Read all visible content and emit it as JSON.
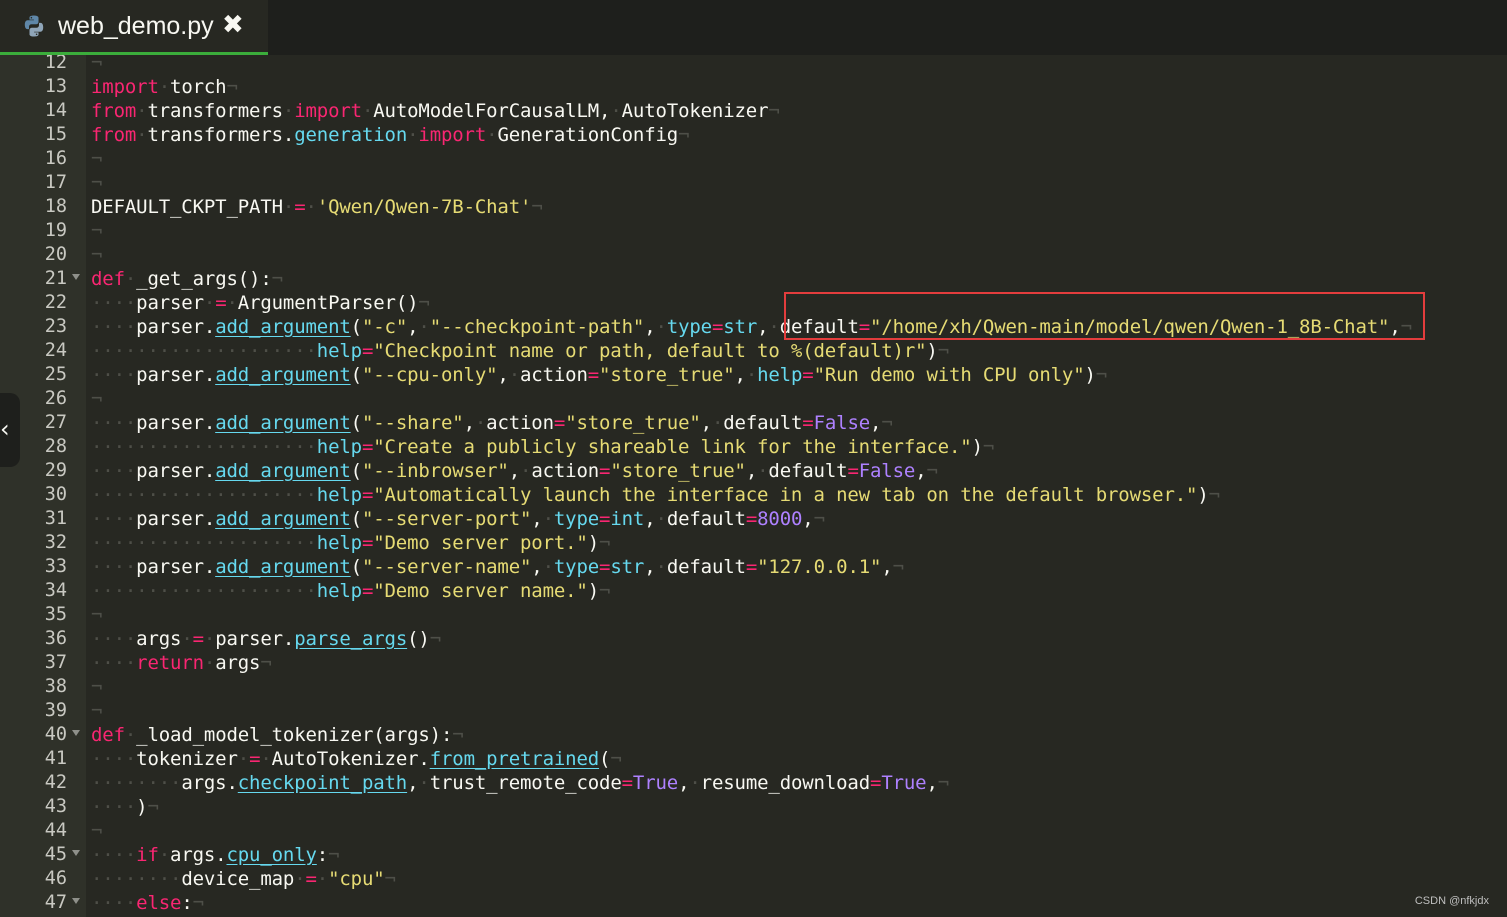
{
  "tab": {
    "title": "web_demo.py",
    "close_glyph": "✖",
    "icon": "python-icon",
    "accent": "#3bad3b"
  },
  "side_toggle": {
    "glyph": "‹",
    "icon": "chevron-left-icon"
  },
  "watermark": "CSDN @nfkjdx",
  "theme": {
    "background": "#272822",
    "keyword": "#f92672",
    "function": "#66d9ef",
    "string": "#e6db74",
    "number": "#ae81ff",
    "highlight_box": "#e33d3d"
  },
  "highlight": {
    "line": 23,
    "text": "default=\"/home/xh/Qwen-main/model/qwen/Qwen-1_8B-Chat\","
  },
  "lines": [
    {
      "n": "12",
      "fold": false,
      "tokens": [
        [
          "ws",
          "¬"
        ]
      ]
    },
    {
      "n": "13",
      "fold": false,
      "tokens": [
        [
          "kw",
          "import"
        ],
        [
          "ws",
          "·"
        ],
        [
          "",
          "torch"
        ],
        [
          "ws",
          "¬"
        ]
      ]
    },
    {
      "n": "14",
      "fold": false,
      "tokens": [
        [
          "kw",
          "from"
        ],
        [
          "ws",
          "·"
        ],
        [
          "",
          "transformers"
        ],
        [
          "ws",
          "·"
        ],
        [
          "kw",
          "import"
        ],
        [
          "ws",
          "·"
        ],
        [
          "",
          "AutoModelForCausalLM,"
        ],
        [
          "ws",
          "·"
        ],
        [
          "",
          "AutoTokenizer"
        ],
        [
          "ws",
          "¬"
        ]
      ]
    },
    {
      "n": "15",
      "fold": false,
      "tokens": [
        [
          "kw",
          "from"
        ],
        [
          "ws",
          "·"
        ],
        [
          "",
          "transformers."
        ],
        [
          "bi",
          "generation"
        ],
        [
          "ws",
          "·"
        ],
        [
          "kw",
          "import"
        ],
        [
          "ws",
          "·"
        ],
        [
          "",
          "GenerationConfig"
        ],
        [
          "ws",
          "¬"
        ]
      ]
    },
    {
      "n": "16",
      "fold": false,
      "tokens": [
        [
          "ws",
          "¬"
        ]
      ]
    },
    {
      "n": "17",
      "fold": false,
      "tokens": [
        [
          "ws",
          "¬"
        ]
      ]
    },
    {
      "n": "18",
      "fold": false,
      "tokens": [
        [
          "",
          "DEFAULT_CKPT_PATH"
        ],
        [
          "ws",
          "·"
        ],
        [
          "op",
          "="
        ],
        [
          "ws",
          "·"
        ],
        [
          "str",
          "'Qwen/Qwen-7B-Chat'"
        ],
        [
          "ws",
          "¬"
        ]
      ]
    },
    {
      "n": "19",
      "fold": false,
      "tokens": [
        [
          "ws",
          "¬"
        ]
      ]
    },
    {
      "n": "20",
      "fold": false,
      "tokens": [
        [
          "ws",
          "¬"
        ]
      ]
    },
    {
      "n": "21",
      "fold": true,
      "tokens": [
        [
          "kw",
          "def"
        ],
        [
          "ws",
          "·"
        ],
        [
          "",
          "_get_args():"
        ],
        [
          "ws",
          "¬"
        ]
      ]
    },
    {
      "n": "22",
      "fold": false,
      "tokens": [
        [
          "ws",
          "····"
        ],
        [
          "",
          "parser"
        ],
        [
          "ws",
          "·"
        ],
        [
          "op",
          "="
        ],
        [
          "ws",
          "·"
        ],
        [
          "",
          "ArgumentParser()"
        ],
        [
          "ws",
          "¬"
        ]
      ]
    },
    {
      "n": "23",
      "fold": false,
      "tokens": [
        [
          "ws",
          "····"
        ],
        [
          "",
          "parser."
        ],
        [
          "fn",
          "add_argument"
        ],
        [
          "",
          "("
        ],
        [
          "str",
          "\"-c\""
        ],
        [
          "",
          ","
        ],
        [
          "ws",
          "·"
        ],
        [
          "str",
          "\"--checkpoint-path\""
        ],
        [
          "",
          ","
        ],
        [
          "ws",
          "·"
        ],
        [
          "bi",
          "type"
        ],
        [
          "op",
          "="
        ],
        [
          "bi",
          "str"
        ],
        [
          "",
          ","
        ],
        [
          "ws",
          "·"
        ],
        [
          "",
          "default"
        ],
        [
          "op",
          "="
        ],
        [
          "str",
          "\"/home/xh/Qwen-main/model/qwen/Qwen-1_8B-Chat\""
        ],
        [
          "",
          ","
        ],
        [
          "ws",
          "¬"
        ]
      ]
    },
    {
      "n": "24",
      "fold": false,
      "tokens": [
        [
          "ws",
          "····················"
        ],
        [
          "bi",
          "help"
        ],
        [
          "op",
          "="
        ],
        [
          "str",
          "\"Checkpoint name or path, default to %(default)r\""
        ],
        [
          "",
          ")"
        ],
        [
          "ws",
          "¬"
        ]
      ]
    },
    {
      "n": "25",
      "fold": false,
      "tokens": [
        [
          "ws",
          "····"
        ],
        [
          "",
          "parser."
        ],
        [
          "fn",
          "add_argument"
        ],
        [
          "",
          "("
        ],
        [
          "str",
          "\"--cpu-only\""
        ],
        [
          "",
          ","
        ],
        [
          "ws",
          "·"
        ],
        [
          "",
          "action"
        ],
        [
          "op",
          "="
        ],
        [
          "str",
          "\"store_true\""
        ],
        [
          "",
          ","
        ],
        [
          "ws",
          "·"
        ],
        [
          "bi",
          "help"
        ],
        [
          "op",
          "="
        ],
        [
          "str",
          "\"Run demo with CPU only\""
        ],
        [
          "",
          ")"
        ],
        [
          "ws",
          "¬"
        ]
      ]
    },
    {
      "n": "26",
      "fold": false,
      "tokens": [
        [
          "ws",
          "¬"
        ]
      ]
    },
    {
      "n": "27",
      "fold": false,
      "tokens": [
        [
          "ws",
          "····"
        ],
        [
          "",
          "parser."
        ],
        [
          "fn",
          "add_argument"
        ],
        [
          "",
          "("
        ],
        [
          "str",
          "\"--share\""
        ],
        [
          "",
          ","
        ],
        [
          "ws",
          "·"
        ],
        [
          "",
          "action"
        ],
        [
          "op",
          "="
        ],
        [
          "str",
          "\"store_true\""
        ],
        [
          "",
          ","
        ],
        [
          "ws",
          "·"
        ],
        [
          "",
          "default"
        ],
        [
          "op",
          "="
        ],
        [
          "num",
          "False"
        ],
        [
          "",
          ","
        ],
        [
          "ws",
          "¬"
        ]
      ]
    },
    {
      "n": "28",
      "fold": false,
      "tokens": [
        [
          "ws",
          "····················"
        ],
        [
          "bi",
          "help"
        ],
        [
          "op",
          "="
        ],
        [
          "str",
          "\"Create a publicly shareable link for the interface.\""
        ],
        [
          "",
          ")"
        ],
        [
          "ws",
          "¬"
        ]
      ]
    },
    {
      "n": "29",
      "fold": false,
      "tokens": [
        [
          "ws",
          "····"
        ],
        [
          "",
          "parser."
        ],
        [
          "fn",
          "add_argument"
        ],
        [
          "",
          "("
        ],
        [
          "str",
          "\"--inbrowser\""
        ],
        [
          "",
          ","
        ],
        [
          "ws",
          "·"
        ],
        [
          "",
          "action"
        ],
        [
          "op",
          "="
        ],
        [
          "str",
          "\"store_true\""
        ],
        [
          "",
          ","
        ],
        [
          "ws",
          "·"
        ],
        [
          "",
          "default"
        ],
        [
          "op",
          "="
        ],
        [
          "num",
          "False"
        ],
        [
          "",
          ","
        ],
        [
          "ws",
          "¬"
        ]
      ]
    },
    {
      "n": "30",
      "fold": false,
      "tokens": [
        [
          "ws",
          "····················"
        ],
        [
          "bi",
          "help"
        ],
        [
          "op",
          "="
        ],
        [
          "str",
          "\"Automatically launch the interface in a new tab on the default browser.\""
        ],
        [
          "",
          ")"
        ],
        [
          "ws",
          "¬"
        ]
      ]
    },
    {
      "n": "31",
      "fold": false,
      "tokens": [
        [
          "ws",
          "····"
        ],
        [
          "",
          "parser."
        ],
        [
          "fn",
          "add_argument"
        ],
        [
          "",
          "("
        ],
        [
          "str",
          "\"--server-port\""
        ],
        [
          "",
          ","
        ],
        [
          "ws",
          "·"
        ],
        [
          "bi",
          "type"
        ],
        [
          "op",
          "="
        ],
        [
          "bi",
          "int"
        ],
        [
          "",
          ","
        ],
        [
          "ws",
          "·"
        ],
        [
          "",
          "default"
        ],
        [
          "op",
          "="
        ],
        [
          "num",
          "8000"
        ],
        [
          "",
          ","
        ],
        [
          "ws",
          "¬"
        ]
      ]
    },
    {
      "n": "32",
      "fold": false,
      "tokens": [
        [
          "ws",
          "····················"
        ],
        [
          "bi",
          "help"
        ],
        [
          "op",
          "="
        ],
        [
          "str",
          "\"Demo server port.\""
        ],
        [
          "",
          ")"
        ],
        [
          "ws",
          "¬"
        ]
      ]
    },
    {
      "n": "33",
      "fold": false,
      "tokens": [
        [
          "ws",
          "····"
        ],
        [
          "",
          "parser."
        ],
        [
          "fn",
          "add_argument"
        ],
        [
          "",
          "("
        ],
        [
          "str",
          "\"--server-name\""
        ],
        [
          "",
          ","
        ],
        [
          "ws",
          "·"
        ],
        [
          "bi",
          "type"
        ],
        [
          "op",
          "="
        ],
        [
          "bi",
          "str"
        ],
        [
          "",
          ","
        ],
        [
          "ws",
          "·"
        ],
        [
          "",
          "default"
        ],
        [
          "op",
          "="
        ],
        [
          "str",
          "\"127.0.0.1\""
        ],
        [
          "",
          ","
        ],
        [
          "ws",
          "¬"
        ]
      ]
    },
    {
      "n": "34",
      "fold": false,
      "tokens": [
        [
          "ws",
          "····················"
        ],
        [
          "bi",
          "help"
        ],
        [
          "op",
          "="
        ],
        [
          "str",
          "\"Demo server name.\""
        ],
        [
          "",
          ")"
        ],
        [
          "ws",
          "¬"
        ]
      ]
    },
    {
      "n": "35",
      "fold": false,
      "tokens": [
        [
          "ws",
          "¬"
        ]
      ]
    },
    {
      "n": "36",
      "fold": false,
      "tokens": [
        [
          "ws",
          "····"
        ],
        [
          "",
          "args"
        ],
        [
          "ws",
          "·"
        ],
        [
          "op",
          "="
        ],
        [
          "ws",
          "·"
        ],
        [
          "",
          "parser."
        ],
        [
          "fn",
          "parse_args"
        ],
        [
          "",
          "()"
        ],
        [
          "ws",
          "¬"
        ]
      ]
    },
    {
      "n": "37",
      "fold": false,
      "tokens": [
        [
          "ws",
          "····"
        ],
        [
          "kw",
          "return"
        ],
        [
          "ws",
          "·"
        ],
        [
          "",
          "args"
        ],
        [
          "ws",
          "¬"
        ]
      ]
    },
    {
      "n": "38",
      "fold": false,
      "tokens": [
        [
          "ws",
          "¬"
        ]
      ]
    },
    {
      "n": "39",
      "fold": false,
      "tokens": [
        [
          "ws",
          "¬"
        ]
      ]
    },
    {
      "n": "40",
      "fold": true,
      "tokens": [
        [
          "kw",
          "def"
        ],
        [
          "ws",
          "·"
        ],
        [
          "",
          "_load_model_tokenizer(args):"
        ],
        [
          "ws",
          "¬"
        ]
      ]
    },
    {
      "n": "41",
      "fold": false,
      "tokens": [
        [
          "ws",
          "····"
        ],
        [
          "",
          "tokenizer"
        ],
        [
          "ws",
          "·"
        ],
        [
          "op",
          "="
        ],
        [
          "ws",
          "·"
        ],
        [
          "",
          "AutoTokenizer."
        ],
        [
          "fn",
          "from_pretrained"
        ],
        [
          "",
          "("
        ],
        [
          "ws",
          "¬"
        ]
      ]
    },
    {
      "n": "42",
      "fold": false,
      "tokens": [
        [
          "ws",
          "········"
        ],
        [
          "",
          "args."
        ],
        [
          "fn",
          "checkpoint_path"
        ],
        [
          "",
          ","
        ],
        [
          "ws",
          "·"
        ],
        [
          "",
          "trust_remote_code"
        ],
        [
          "op",
          "="
        ],
        [
          "num",
          "True"
        ],
        [
          "",
          ","
        ],
        [
          "ws",
          "·"
        ],
        [
          "",
          "resume_download"
        ],
        [
          "op",
          "="
        ],
        [
          "num",
          "True"
        ],
        [
          "",
          ","
        ],
        [
          "ws",
          "¬"
        ]
      ]
    },
    {
      "n": "43",
      "fold": false,
      "tokens": [
        [
          "ws",
          "····"
        ],
        [
          "",
          ")"
        ],
        [
          "ws",
          "¬"
        ]
      ]
    },
    {
      "n": "44",
      "fold": false,
      "tokens": [
        [
          "ws",
          "¬"
        ]
      ]
    },
    {
      "n": "45",
      "fold": true,
      "tokens": [
        [
          "ws",
          "····"
        ],
        [
          "kw",
          "if"
        ],
        [
          "ws",
          "·"
        ],
        [
          "",
          "args."
        ],
        [
          "fn",
          "cpu_only"
        ],
        [
          "",
          ":"
        ],
        [
          "ws",
          "¬"
        ]
      ]
    },
    {
      "n": "46",
      "fold": false,
      "tokens": [
        [
          "ws",
          "········"
        ],
        [
          "",
          "device_map"
        ],
        [
          "ws",
          "·"
        ],
        [
          "op",
          "="
        ],
        [
          "ws",
          "·"
        ],
        [
          "str",
          "\"cpu\""
        ],
        [
          "ws",
          "¬"
        ]
      ]
    },
    {
      "n": "47",
      "fold": true,
      "tokens": [
        [
          "ws",
          "····"
        ],
        [
          "kw",
          "else"
        ],
        [
          "",
          ":"
        ],
        [
          "ws",
          "¬"
        ]
      ]
    }
  ]
}
